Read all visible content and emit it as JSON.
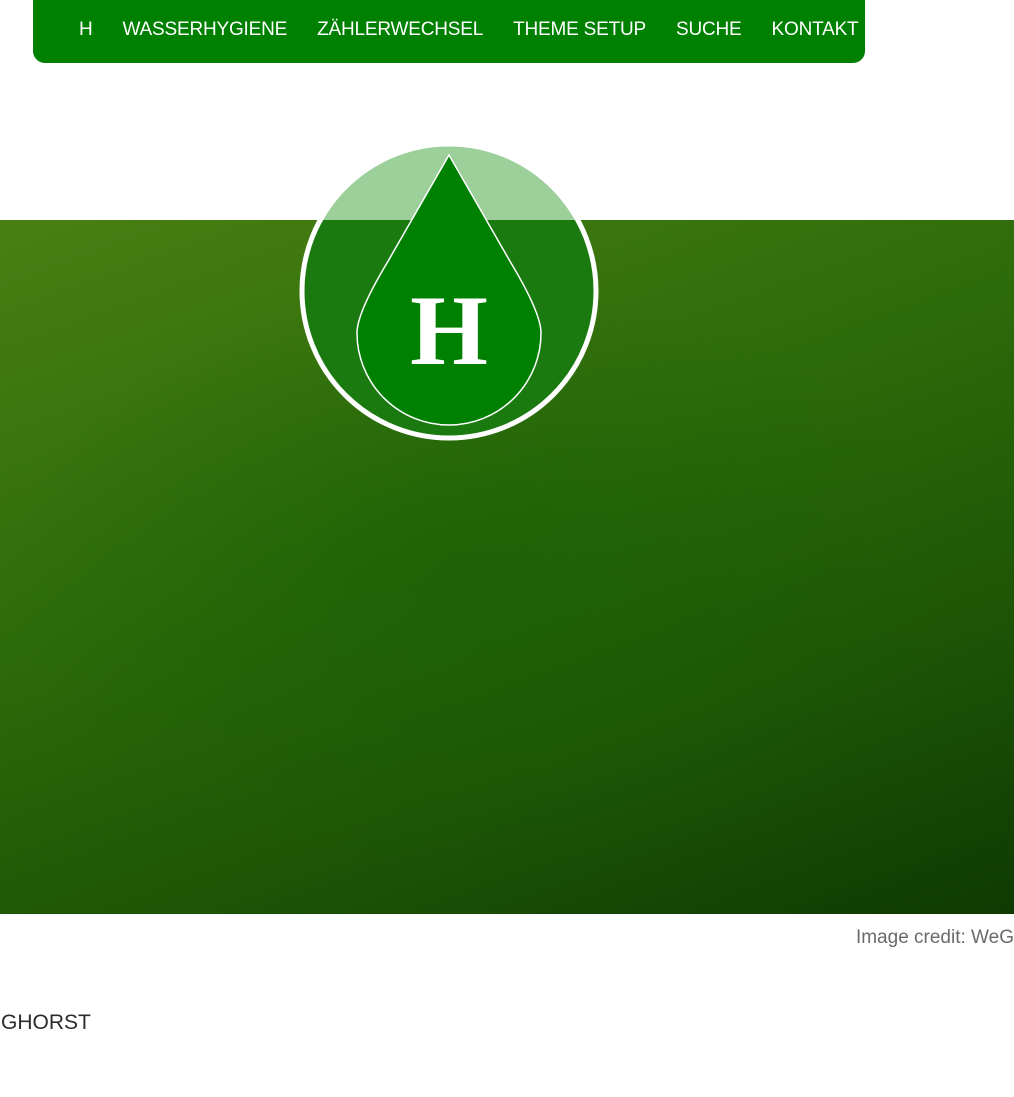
{
  "nav": {
    "items": [
      {
        "label": "H"
      },
      {
        "label": "WASSERHYGIENE"
      },
      {
        "label": "ZÄHLERWECHSEL"
      },
      {
        "label": "THEME SETUP"
      },
      {
        "label": "SUCHE"
      },
      {
        "label": "KONTAKT"
      }
    ]
  },
  "logo": {
    "letter": "H",
    "icon": "water-drop-icon"
  },
  "hero": {
    "credit": "Image credit: WeG"
  },
  "footer": {
    "site_name": "GHORST"
  },
  "colors": {
    "nav_bg": "#008000",
    "logo_top": "#9dcf9b",
    "logo_body": "#1a7a10",
    "drop": "#008000",
    "hero_top": "#4a7f12",
    "hero_bottom": "#0f3a02"
  }
}
